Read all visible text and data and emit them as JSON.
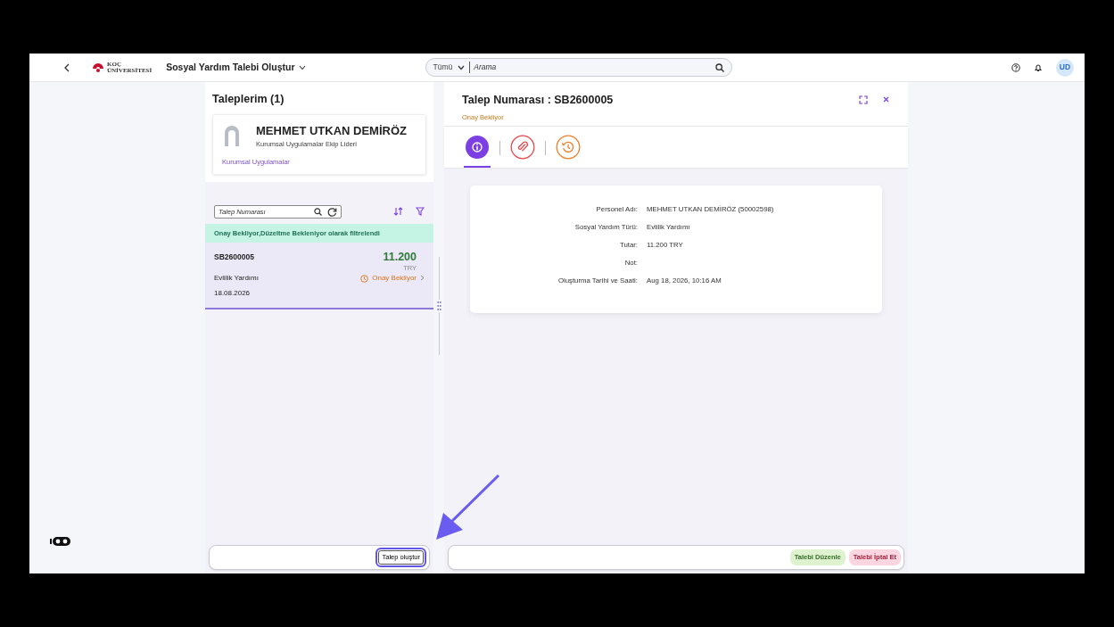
{
  "header": {
    "logo_lines": [
      "KOÇ",
      "ÜNİVERSİTESİ"
    ],
    "app_title": "Sosyal Yardım Talebi Oluştur",
    "search_scope": "Tümü",
    "search_placeholder": "Arama",
    "avatar": "UD"
  },
  "list_panel": {
    "title": "Taleplerim (1)",
    "profile": {
      "name": "MEHMET UTKAN DEMİRÖZ",
      "role": "Kurumsal Uygulamalar Ekip Lideri",
      "department": "Kurumsal Uygulamalar"
    },
    "filter_placeholder": "Talep Numarası",
    "filter_banner": "Onay Bekliyor,Düzeltme Bekleniyor olarak filtrelendi",
    "requests": [
      {
        "number": "SB2600005",
        "amount": "11.200",
        "currency": "TRY",
        "type": "Evlilik Yardımı",
        "status": "Onay Bekliyor",
        "date": "18.08.2026",
        "selected": true
      }
    ],
    "create_button": "Talep oluştur"
  },
  "detail": {
    "title": "Talep Numarası : SB2600005",
    "status": "Onay Bekliyor",
    "tabs": [
      {
        "kind": "info",
        "selected": true,
        "color": "#7b3fe4"
      },
      {
        "kind": "attachment",
        "selected": false,
        "color": "#e8474c"
      },
      {
        "kind": "history",
        "selected": false,
        "color": "#e9822a"
      }
    ],
    "fields": [
      {
        "label": "Personel Adı:",
        "value": "MEHMET UTKAN DEMİRÖZ (50002598)"
      },
      {
        "label": "Sosyal Yardım Türü:",
        "value": "Evlilik Yardımı"
      },
      {
        "label": "Tutar:",
        "value": "11.200 TRY"
      },
      {
        "label": "Not:"
      },
      {
        "label": "Oluşturma Tarihi ve Saati:",
        "value": "Aug 18, 2026, 10:16 AM"
      }
    ],
    "actions": [
      {
        "label": "Talebi Düzenle",
        "kind": "edit"
      },
      {
        "label": "Talebi İptal Et",
        "kind": "cancel"
      }
    ]
  }
}
